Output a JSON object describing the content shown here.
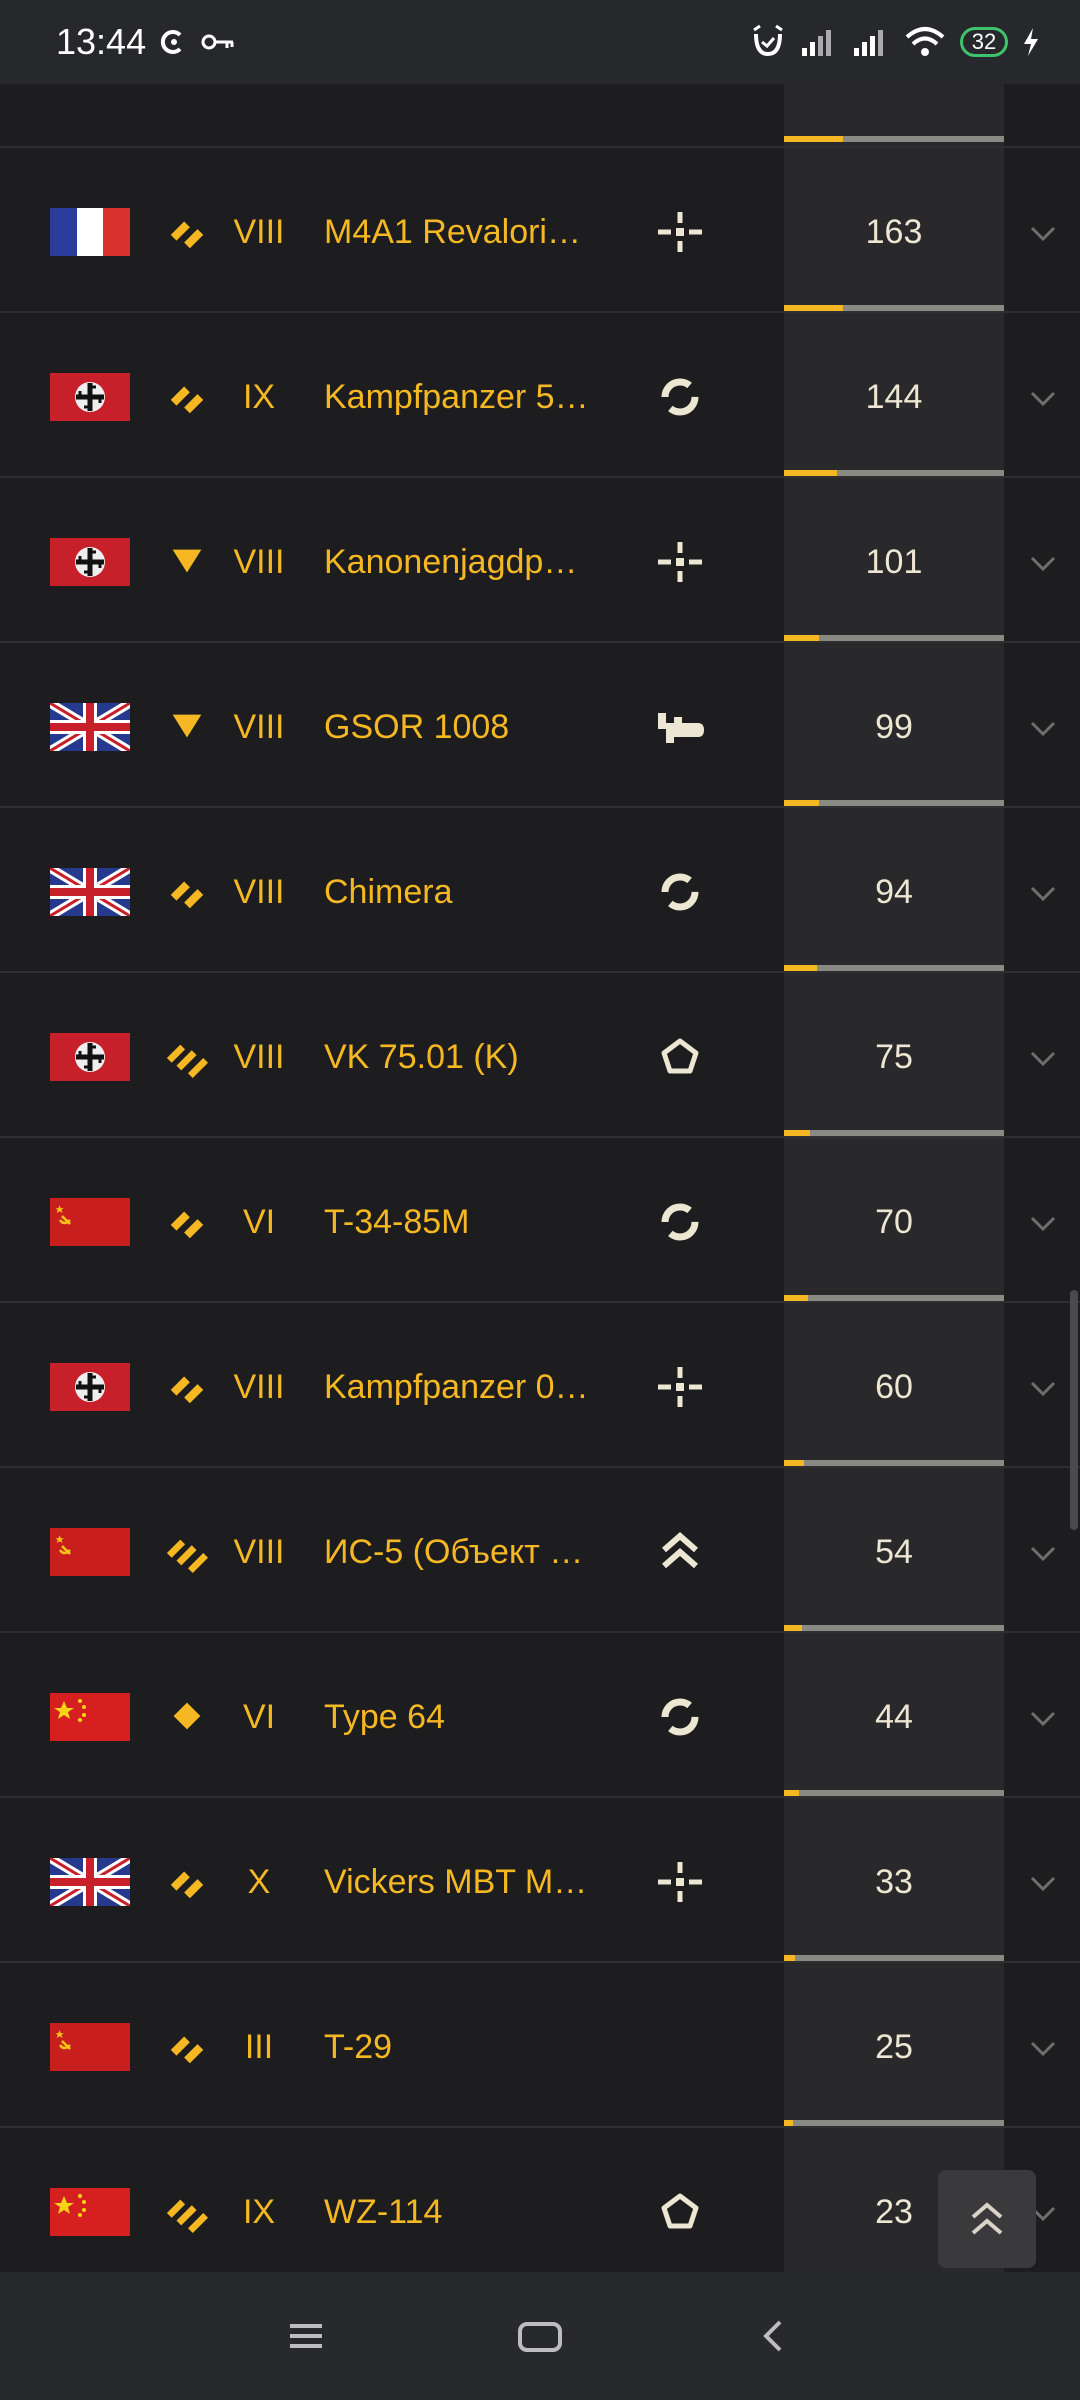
{
  "status_bar": {
    "time": "13:44",
    "battery": "32"
  },
  "rows": [
    {
      "flag": "france",
      "class_icon": "light-tank-icon",
      "tier": "VIII",
      "name": "M4A1 Revalori…",
      "role_icon": "crosshair-icon",
      "value": "163",
      "progress": 0.27
    },
    {
      "flag": "germany",
      "class_icon": "light-tank-icon",
      "tier": "IX",
      "name": "Kampfpanzer 5…",
      "role_icon": "cycle-icon",
      "value": "144",
      "progress": 0.24
    },
    {
      "flag": "germany",
      "class_icon": "tank-destroyer-icon",
      "tier": "VIII",
      "name": "Kanonenjagdp…",
      "role_icon": "crosshair-icon",
      "value": "101",
      "progress": 0.16
    },
    {
      "flag": "uk",
      "class_icon": "tank-destroyer-icon",
      "tier": "VIII",
      "name": "GSOR 1008",
      "role_icon": "gun-icon",
      "value": "99",
      "progress": 0.16
    },
    {
      "flag": "uk",
      "class_icon": "light-tank-icon",
      "tier": "VIII",
      "name": "Chimera",
      "role_icon": "cycle-icon",
      "value": "94",
      "progress": 0.15
    },
    {
      "flag": "germany",
      "class_icon": "heavy-tank-icon",
      "tier": "VIII",
      "name": "VK 75.01 (K)",
      "role_icon": "pentagon-icon",
      "value": "75",
      "progress": 0.12
    },
    {
      "flag": "ussr",
      "class_icon": "light-tank-icon",
      "tier": "VI",
      "name": "T-34-85M",
      "role_icon": "cycle-icon",
      "value": "70",
      "progress": 0.11
    },
    {
      "flag": "germany",
      "class_icon": "light-tank-icon",
      "tier": "VIII",
      "name": "Kampfpanzer 0…",
      "role_icon": "crosshair-icon",
      "value": "60",
      "progress": 0.09
    },
    {
      "flag": "ussr",
      "class_icon": "heavy-tank-icon",
      "tier": "VIII",
      "name": "ИС-5 (Объект …",
      "role_icon": "chevron-up-icon",
      "value": "54",
      "progress": 0.08
    },
    {
      "flag": "china",
      "class_icon": "diamond-icon",
      "tier": "VI",
      "name": "Type 64",
      "role_icon": "cycle-icon",
      "value": "44",
      "progress": 0.07
    },
    {
      "flag": "uk",
      "class_icon": "light-tank-icon",
      "tier": "X",
      "name": "Vickers MBT M…",
      "role_icon": "crosshair-icon",
      "value": "33",
      "progress": 0.05
    },
    {
      "flag": "ussr",
      "class_icon": "light-tank-icon",
      "tier": "III",
      "name": "T-29",
      "role_icon": "",
      "value": "25",
      "progress": 0.04
    },
    {
      "flag": "china",
      "class_icon": "heavy-tank-icon",
      "tier": "IX",
      "name": "WZ-114",
      "role_icon": "pentagon-icon",
      "value": "23",
      "progress": 0.04
    }
  ],
  "colors": {
    "accent": "#f5b823",
    "icon": "#ece6d2",
    "bar_track": "#8a8a84"
  }
}
